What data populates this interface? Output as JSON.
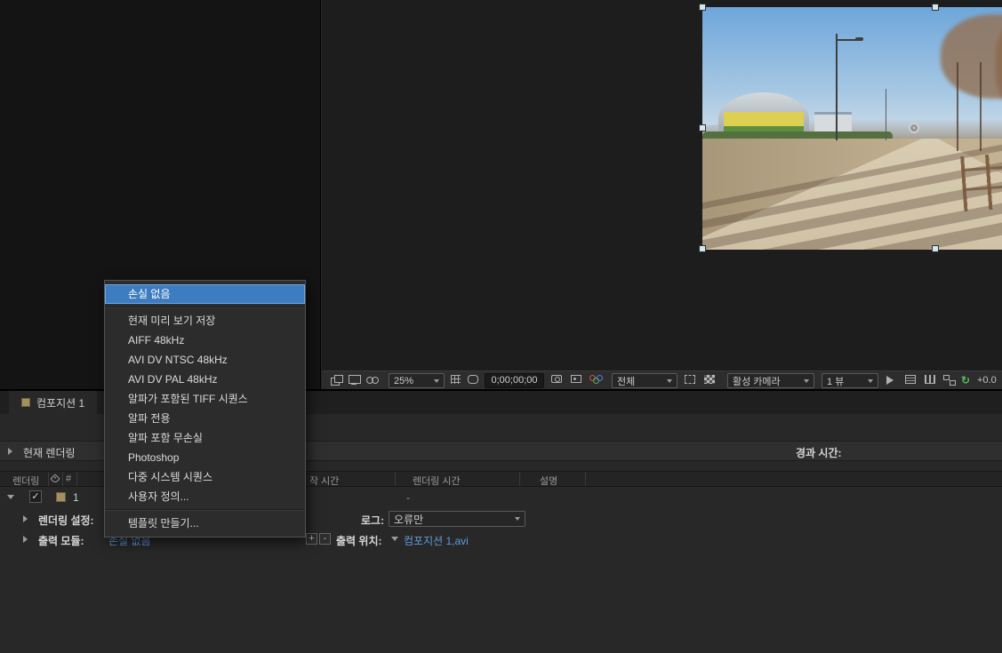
{
  "colors": {
    "menu_highlight": "#3e7cc1",
    "link_blue": "#5f9ad9",
    "exposure_green": "#57b85c",
    "panel_bg": "#282828"
  },
  "viewer_toolbar": {
    "zoom_value": "25%",
    "timecode": "0;00;00;00",
    "resolution_value": "전체",
    "camera_value": "활성 카메라",
    "view_layout_value": "1 뷰",
    "exposure_value": "+0.0",
    "refresh_glyph": "↻"
  },
  "render_queue": {
    "tab_label": "컴포지션 1",
    "current_render_label": "현재 렌더링",
    "elapsed_time_label": "경과 시간:",
    "columns": {
      "render": "렌더링",
      "number": "#",
      "start_time": "작 시간",
      "render_time": "렌더링 시간",
      "comment": "설명"
    },
    "item": {
      "number": "1",
      "check_glyph": "✓",
      "render_time_value": "-",
      "render_settings_label": "렌더링 설정:",
      "log_label": "로그:",
      "log_value": "오류만",
      "output_module_label": "출력 모듈:",
      "output_module_value": "손실 없음",
      "output_to_label": "출력 위치:",
      "output_file": "컴포지션  1,avi",
      "plus_glyph": "+",
      "minus_glyph": "-"
    }
  },
  "menu": {
    "items": [
      "손실 없음",
      "현재 미리 보기 저장",
      "AIFF 48kHz",
      "AVI DV NTSC 48kHz",
      "AVI DV PAL 48kHz",
      "알파가 포함된 TIFF 시퀀스",
      "알파 전용",
      "알파 포함 무손실",
      "Photoshop",
      "다중 시스템 시퀀스",
      "사용자 정의...",
      "템플릿 만들기..."
    ],
    "highlighted_index": 0
  },
  "icons": {
    "snapshot": "camera",
    "show_channel": "rgb rings",
    "transparency_grid": "checkerboard",
    "reset_exposure": "circular arrow",
    "composition": "tan square swatch"
  }
}
